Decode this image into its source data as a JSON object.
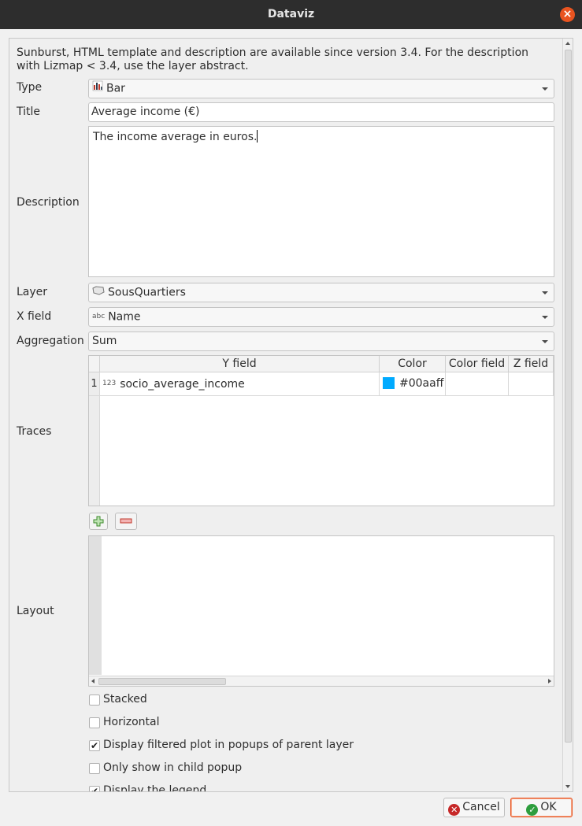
{
  "window": {
    "title": "Dataviz",
    "close_icon": "close-icon",
    "close_glyph": "×"
  },
  "form": {
    "info": "Sunburst, HTML template and description are available since version 3.4. For the description with Lizmap < 3.4, use the layer abstract.",
    "type": {
      "label": "Type",
      "value": "Bar",
      "icon": "bar-chart-icon"
    },
    "title": {
      "label": "Title",
      "value": "Average income (€)"
    },
    "description": {
      "label": "Description",
      "value": "The income average in euros."
    },
    "layer": {
      "label": "Layer",
      "value": "SousQuartiers",
      "icon": "polygon-layer-icon"
    },
    "x_field": {
      "label": "X field",
      "value": "Name",
      "type_badge": "abc"
    },
    "aggregation": {
      "label": "Aggregation",
      "value": "Sum"
    },
    "traces": {
      "label": "Traces",
      "columns": [
        "Y field",
        "Color",
        "Color field",
        "Z field"
      ],
      "rows": [
        {
          "num": "1",
          "type_badge": "123",
          "y_field": "socio_average_income",
          "color_hex": "#00aaff",
          "color_text": "#00aaff",
          "color_field": "",
          "z_field": ""
        }
      ],
      "add_icon": "plus-icon",
      "remove_icon": "minus-icon"
    },
    "layout": {
      "label": "Layout"
    },
    "checkboxes": [
      {
        "label": "Stacked",
        "checked": false
      },
      {
        "label": "Horizontal",
        "checked": false
      },
      {
        "label": "Display filtered plot in popups of parent layer",
        "checked": true
      },
      {
        "label": "Only show in child popup",
        "checked": false
      },
      {
        "label": "Display the legend",
        "checked": true
      }
    ],
    "check_mark": "✔"
  },
  "buttons": {
    "cancel": {
      "label": "Cancel",
      "icon": "cancel-icon",
      "glyph": "✕"
    },
    "ok": {
      "label": "OK",
      "icon": "ok-icon",
      "glyph": "✓"
    }
  },
  "colors": {
    "accent": "#e95420",
    "titlebar": "#2d2d2d",
    "trace_color": "#00aaff"
  }
}
